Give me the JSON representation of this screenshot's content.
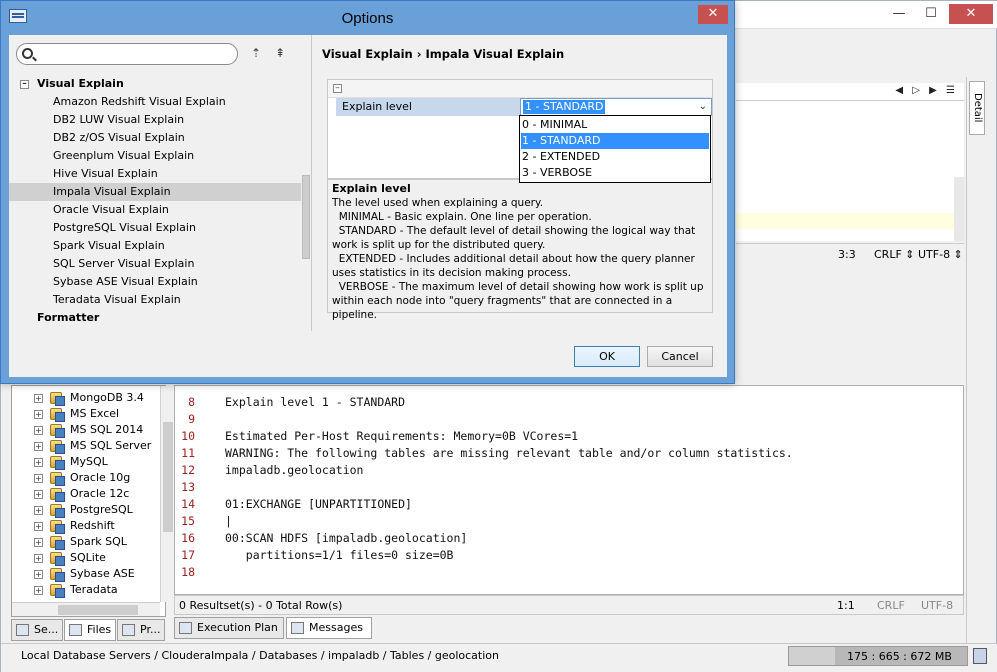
{
  "dialog": {
    "title": "Options",
    "close_label": "✕",
    "search": {
      "value": "",
      "placeholder": ""
    },
    "tree": [
      {
        "label": "Visual Explain",
        "category": true,
        "expanded": true
      },
      {
        "label": "Amazon Redshift Visual Explain"
      },
      {
        "label": "DB2 LUW Visual Explain"
      },
      {
        "label": "DB2 z/OS Visual Explain"
      },
      {
        "label": "Greenplum Visual Explain"
      },
      {
        "label": "Hive Visual Explain"
      },
      {
        "label": "Impala Visual Explain",
        "selected": true
      },
      {
        "label": "Oracle Visual Explain"
      },
      {
        "label": "PostgreSQL Visual Explain"
      },
      {
        "label": "Spark Visual Explain"
      },
      {
        "label": "SQL Server Visual Explain"
      },
      {
        "label": "Sybase ASE Visual Explain"
      },
      {
        "label": "Teradata Visual Explain"
      },
      {
        "label": "Formatter",
        "category": true
      }
    ],
    "breadcrumb": "Visual Explain  ›  Impala Visual Explain",
    "property": {
      "name": "Explain level",
      "value": "1 - STANDARD",
      "options": [
        "0 - MINIMAL",
        "1 - STANDARD",
        "2 - EXTENDED",
        "3 - VERBOSE"
      ],
      "selected_index": 1
    },
    "description": {
      "heading": "Explain level",
      "lines": [
        "The level used when explaining a query.",
        "  MINIMAL - Basic explain. One line per operation.",
        "  STANDARD - The default level of detail showing the logical way that work is split up for the distributed query.",
        "  EXTENDED - Includes additional detail about how the query planner uses statistics in its decision making process.",
        "  VERBOSE - The maximum level of detail showing how work is split up within each node into \"query fragments\" that are connected in a pipeline."
      ]
    },
    "ok_label": "OK",
    "cancel_label": "Cancel"
  },
  "main": {
    "minimize": "—",
    "maximize": "☐",
    "close": "✕",
    "detail_tab": "Detail",
    "editor_nav": "◀ ▷ ▶ ☰",
    "editor_status": {
      "position": "3:3",
      "line_ending": "CRLF ⇕",
      "encoding": "UTF-8 ⇕"
    },
    "tree_items": [
      "MongoDB 3.4",
      "MS Excel",
      "MS SQL 2014",
      "MS SQL Server",
      "MySQL",
      "Oracle 10g",
      "Oracle 12c",
      "PostgreSQL",
      "Redshift",
      "Spark SQL",
      "SQLite",
      "Sybase ASE",
      "Teradata"
    ],
    "left_tabs": [
      "Se...",
      "Files",
      "Pr..."
    ],
    "result_lines": [
      {
        "n": "8",
        "text": "Explain level 1 - STANDARD"
      },
      {
        "n": "9",
        "text": ""
      },
      {
        "n": "10",
        "text": "Estimated Per-Host Requirements: Memory=0B VCores=1"
      },
      {
        "n": "11",
        "text": "WARNING: The following tables are missing relevant table and/or column statistics."
      },
      {
        "n": "12",
        "text": "impaladb.geolocation"
      },
      {
        "n": "13",
        "text": ""
      },
      {
        "n": "14",
        "text": "01:EXCHANGE [UNPARTITIONED]"
      },
      {
        "n": "15",
        "text": "|"
      },
      {
        "n": "16",
        "text": "00:SCAN HDFS [impaladb.geolocation]"
      },
      {
        "n": "17",
        "text": "   partitions=1/1 files=0 size=0B"
      },
      {
        "n": "18",
        "text": ""
      }
    ],
    "result_status": {
      "summary": "0 Resultset(s) - 0 Total Row(s)",
      "position": "1:1",
      "line_ending": "CRLF",
      "encoding": "UTF-8"
    },
    "result_tabs": [
      "Execution Plan",
      "Messages"
    ],
    "status_path": "Local Database Servers / ClouderaImpala / Databases / impaladb / Tables / geolocation",
    "memory": {
      "text": "175 : 665 : 672 MB",
      "used_fraction": 0.26
    }
  }
}
